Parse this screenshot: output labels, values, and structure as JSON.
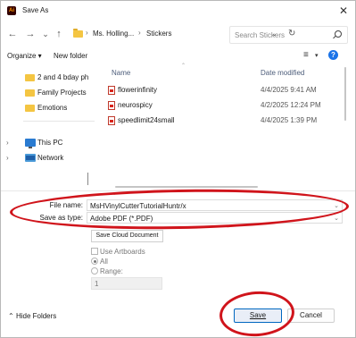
{
  "window": {
    "app_icon_text": "Ai",
    "title": "Save As",
    "close_glyph": "✕"
  },
  "nav": {
    "back_icon": "←",
    "forward_icon": "→",
    "recent_icon": "⌄",
    "up_icon": "↑",
    "breadcrumb": [
      "Ms. Holling...",
      "Stickers"
    ],
    "breadcrumb_sep": "›",
    "address_dropdown": "⌄",
    "refresh_icon": "↻",
    "search_placeholder": "Search Stickers"
  },
  "toolbar": {
    "organize_label": "Organize ▾",
    "new_folder_label": "New folder",
    "view_icon": "≡",
    "view_dropdown": "▾",
    "help_icon": "?"
  },
  "sidebar": {
    "items": [
      {
        "label": "2 and 4 bday ph",
        "icon": "folder-icon"
      },
      {
        "label": "Family Projects",
        "icon": "folder-icon"
      },
      {
        "label": "Emotions",
        "icon": "folder-icon"
      },
      {
        "label": "This PC",
        "icon": "computer-icon",
        "chevron": "›"
      },
      {
        "label": "Network",
        "icon": "network-icon",
        "chevron": "›"
      }
    ]
  },
  "filelist": {
    "columns": {
      "name": "Name",
      "date": "Date modified"
    },
    "sort_caret": "⌃",
    "rows": [
      {
        "name": "flowerinfinity",
        "date": "4/4/2025 9:41 AM"
      },
      {
        "name": "neurospicy",
        "date": "4/2/2025 12:24 PM"
      },
      {
        "name": "speedlimit24small",
        "date": "4/4/2025 1:39 PM"
      }
    ]
  },
  "form": {
    "file_name_label": "File name:",
    "file_name_value": "MsHVinylCutterTutorialHuntr/x",
    "save_type_label": "Save as type:",
    "save_type_value": "Adobe PDF (*.PDF)",
    "dropdown_glyph": "⌄",
    "save_cloud_label": "Save Cloud Document",
    "use_artboards_label": "Use Artboards",
    "all_label": "All",
    "range_label": "Range:",
    "range_value": "1"
  },
  "footer": {
    "hide_folders_label": "Hide Folders",
    "hide_chevron": "⌃",
    "save_label": "Save",
    "cancel_label": "Cancel"
  },
  "colors": {
    "accent": "#0067c0",
    "annotation": "#d0141b",
    "folder": "#f4c542"
  }
}
